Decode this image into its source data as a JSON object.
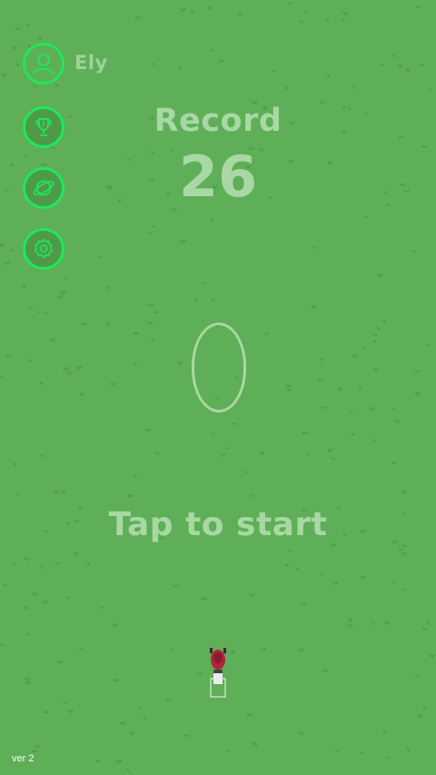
{
  "player": {
    "name": "Ely"
  },
  "menu": {
    "icons": [
      "user-icon",
      "trophy-icon",
      "planet-icon",
      "gear-icon"
    ],
    "accent_color": "#1ee85a"
  },
  "record": {
    "label": "Record",
    "value": "26"
  },
  "prompt": {
    "text": "Tap to start"
  },
  "footer": {
    "version": "ver 2"
  },
  "colors": {
    "grass": "#5fae58",
    "text_faded": "#a8d8a3"
  }
}
